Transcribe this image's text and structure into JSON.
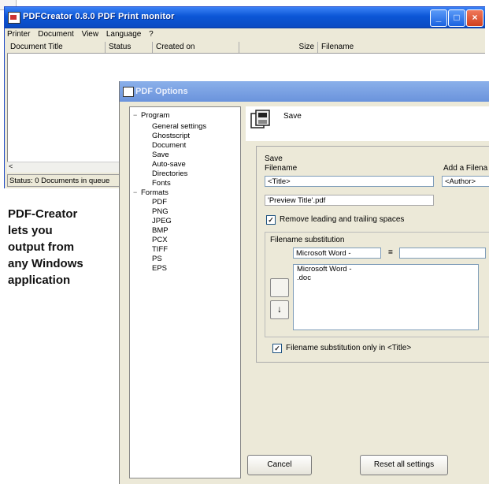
{
  "monitor": {
    "title": "PDFCreator 0.8.0 PDF Print monitor",
    "menu": [
      "Printer",
      "Document",
      "View",
      "Language",
      "?"
    ],
    "columns": [
      "Document Title",
      "Status",
      "Created on",
      "Size",
      "Filename"
    ],
    "status": "Status: 0 Documents in queue",
    "scroll_arrow": "<"
  },
  "caption": [
    "PDF-Creator",
    "lets you",
    "output from",
    "any Windows",
    "application"
  ],
  "options": {
    "title": "PDF Options",
    "tree": {
      "program": "Program",
      "program_items": [
        "General settings",
        "Ghostscript",
        "Document",
        "Save",
        "Auto-save",
        "Directories",
        "Fonts"
      ],
      "formats": "Formats",
      "format_items": [
        "PDF",
        "PNG",
        "JPEG",
        "BMP",
        "PCX",
        "TIFF",
        "PS",
        "EPS"
      ]
    },
    "header_label": "Save",
    "save_group_label": "Save",
    "filename_label": "Filename",
    "add_filename_label": "Add a Filena",
    "filename_value": "<Title>",
    "add_filename_value": "<Author>",
    "preview": "'Preview Title'.pdf",
    "remove_spaces_label": "Remove leading and trailing spaces",
    "remove_spaces_checked": true,
    "subst_label": "Filename substitution",
    "subst_from": "Microsoft Word -",
    "subst_eq": "=",
    "subst_to": "",
    "subst_list": [
      "Microsoft Word -",
      ".doc"
    ],
    "subst_only_title_label": "Filename substitution only in <Title>",
    "subst_only_title_checked": true,
    "up_arrow": "↑",
    "down_arrow": "↓",
    "cancel": "Cancel",
    "reset": "Reset all settings"
  }
}
